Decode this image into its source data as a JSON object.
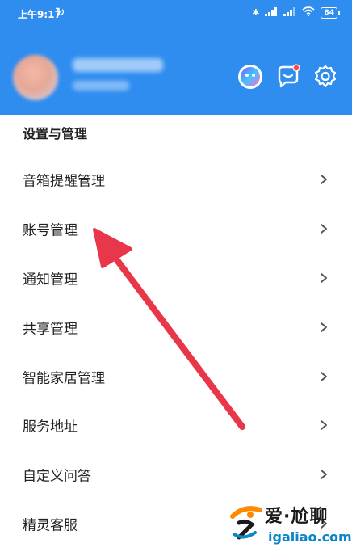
{
  "status_bar": {
    "time": "上午9:17",
    "battery": "84"
  },
  "header": {
    "icons": [
      "assistant-icon",
      "message-icon",
      "settings-icon"
    ],
    "accent": "#2f8df0",
    "badge_color": "#ff4d4f"
  },
  "section": {
    "title": "设置与管理",
    "items": [
      {
        "label": "音箱提醒管理"
      },
      {
        "label": "账号管理"
      },
      {
        "label": "通知管理"
      },
      {
        "label": "共享管理"
      },
      {
        "label": "智能家居管理"
      },
      {
        "label": "服务地址"
      },
      {
        "label": "自定义问答"
      },
      {
        "label": "精灵客服"
      }
    ]
  },
  "annotation": {
    "arrow_color": "#e8364a",
    "points_to": "账号管理"
  },
  "watermark": {
    "name": "爱·尬聊",
    "url": "igaliao.com"
  }
}
